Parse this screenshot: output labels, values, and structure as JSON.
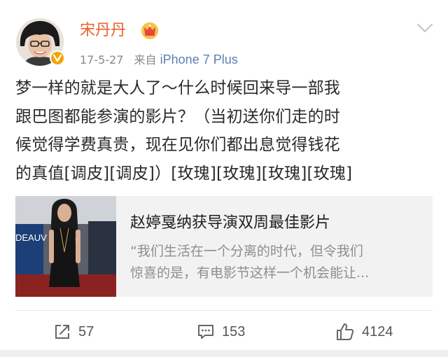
{
  "post": {
    "author": "宋丹丹",
    "timestamp": "17-5-27",
    "source_prefix": "来自",
    "source": "iPhone 7 Plus",
    "content_lines": [
      "梦一样的就是大人了～什么时候回来导一部我",
      "跟巴图都能参演的影片？（当初送你们走的时",
      "候觉得学费真贵，现在见你们都出息觉得钱花",
      "的真值[调皮][调皮]）[玫瑰][玫瑰][玫瑰][玫瑰]"
    ]
  },
  "card": {
    "title": "赵婷戛纳获导演双周最佳影片",
    "desc_lines": [
      "“我们生活在一个分离的时代，但令我们",
      "惊喜的是，有电影节这样一个机会能让..."
    ],
    "thumb_text": "DEAUV"
  },
  "actions": {
    "repost_count": "57",
    "comment_count": "153",
    "like_count": "4124"
  },
  "icons": {
    "avatar": "avatar",
    "verified": "verified-badge-icon",
    "crown": "crown-icon",
    "chevron": "chevron-down-icon",
    "repost": "repost-icon",
    "comment": "comment-icon",
    "like": "like-icon"
  },
  "colors": {
    "author": "#e8622c",
    "source": "#5b7fb3",
    "verified": "#f5a300",
    "card_bg": "#f2f2f2"
  }
}
